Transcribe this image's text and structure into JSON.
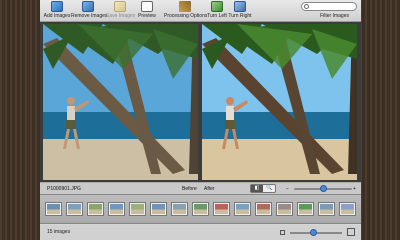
{
  "toolbar": {
    "items": [
      {
        "label": "Add Images",
        "icon": "add-images-icon",
        "enabled": true
      },
      {
        "label": "Remove Images",
        "icon": "remove-images-icon",
        "enabled": true
      },
      {
        "label": "Save Images",
        "icon": "save-images-icon",
        "enabled": false
      },
      {
        "label": "Preview",
        "icon": "preview-icon",
        "enabled": true
      },
      {
        "label": "Processing Options",
        "icon": "processing-options-icon",
        "enabled": true
      },
      {
        "label": "Turn Left",
        "icon": "turn-left-icon",
        "enabled": true
      },
      {
        "label": "Turn Right",
        "icon": "turn-right-icon",
        "enabled": true
      }
    ],
    "search_label": "Filter Images",
    "search_value": ""
  },
  "info": {
    "filename": "P1000901.JPG",
    "before_label": "Before",
    "after_label": "After",
    "zoom_minus": "−",
    "zoom_plus": "+",
    "zoom_level": 0.5
  },
  "status": {
    "count": "15 images",
    "size_level": 0.45
  },
  "colors": {
    "sky_before": "#5aa6d8",
    "sky_after": "#7ec3ee",
    "sea": "#1d6f9a",
    "sand": "#cdbfa3"
  }
}
